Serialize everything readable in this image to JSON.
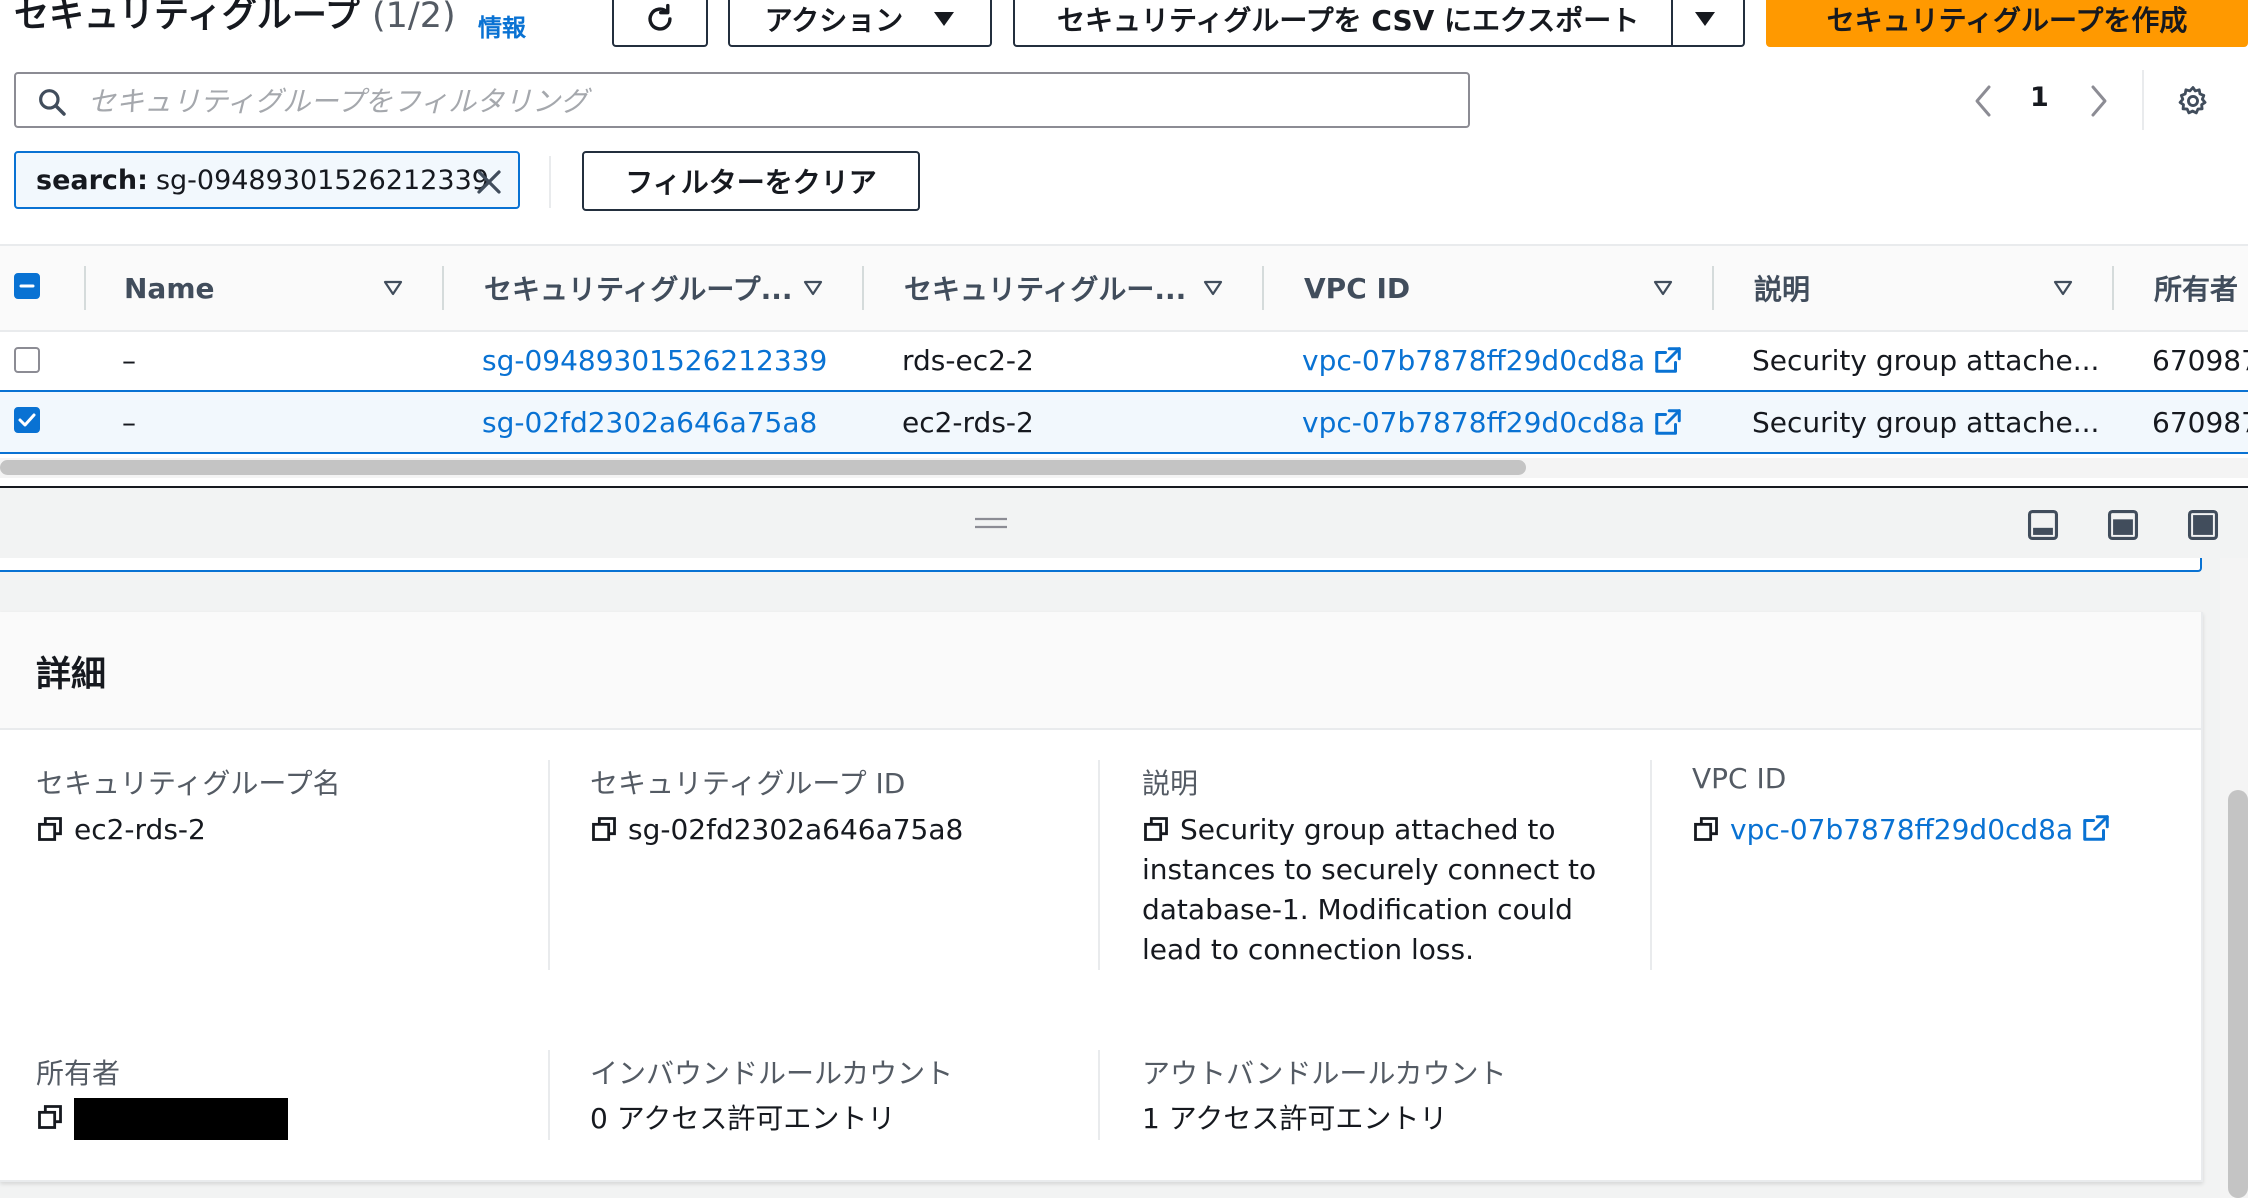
{
  "header": {
    "title": "セキュリティグループ",
    "count": "(1/2)",
    "info": "情報",
    "actions_label": "アクション",
    "export_label": "セキュリティグループを CSV にエクスポート",
    "create_label": "セキュリティグループを作成"
  },
  "filter": {
    "placeholder": "セキュリティグループをフィルタリング",
    "value": "",
    "token_key": "search:",
    "token_value": "sg-09489301526212339",
    "clear_label": "フィルターをクリア"
  },
  "pagination": {
    "current_page": "1"
  },
  "table": {
    "columns": [
      "Name",
      "セキュリティグループ...",
      "セキュリティグルー...",
      "VPC ID",
      "説明",
      "所有者"
    ],
    "rows": [
      {
        "selected": false,
        "name": "–",
        "sg_id": "sg-09489301526212339",
        "sg_name": "rds-ec2-2",
        "vpc_id": "vpc-07b7878ff29d0cd8a",
        "description": "Security group attache...",
        "owner": "670987"
      },
      {
        "selected": true,
        "name": "–",
        "sg_id": "sg-02fd2302a646a75a8",
        "sg_name": "ec2-rds-2",
        "vpc_id": "vpc-07b7878ff29d0cd8a",
        "description": "Security group attache...",
        "owner": "670987"
      }
    ]
  },
  "details": {
    "title": "詳細",
    "fields": {
      "sg_name": {
        "label": "セキュリティグループ名",
        "value": "ec2-rds-2"
      },
      "sg_id": {
        "label": "セキュリティグループ ID",
        "value": "sg-02fd2302a646a75a8"
      },
      "description": {
        "label": "説明",
        "value": "Security group attached to instances to securely connect to database-1. Modification could lead to connection loss."
      },
      "vpc_id": {
        "label": "VPC ID",
        "value": "vpc-07b7878ff29d0cd8a"
      },
      "owner": {
        "label": "所有者"
      },
      "inbound": {
        "label": "インバウンドルールカウント",
        "value": "0 アクセス許可エントリ"
      },
      "outbound": {
        "label": "アウトバンドルールカウント",
        "value": "1 アクセス許可エントリ"
      }
    }
  },
  "colors": {
    "link": "#0972d3",
    "primary_button": "#ff9900",
    "selected_row": "#f2f8fd"
  },
  "icons": [
    "refresh-icon",
    "caret-down-icon",
    "search-icon",
    "chevron-left-icon",
    "chevron-right-icon",
    "gear-icon",
    "close-icon",
    "sort-caret-icon",
    "external-link-icon",
    "copy-icon",
    "drag-handle-icon",
    "panel-bottom-icon",
    "panel-side-icon",
    "panel-full-icon"
  ]
}
